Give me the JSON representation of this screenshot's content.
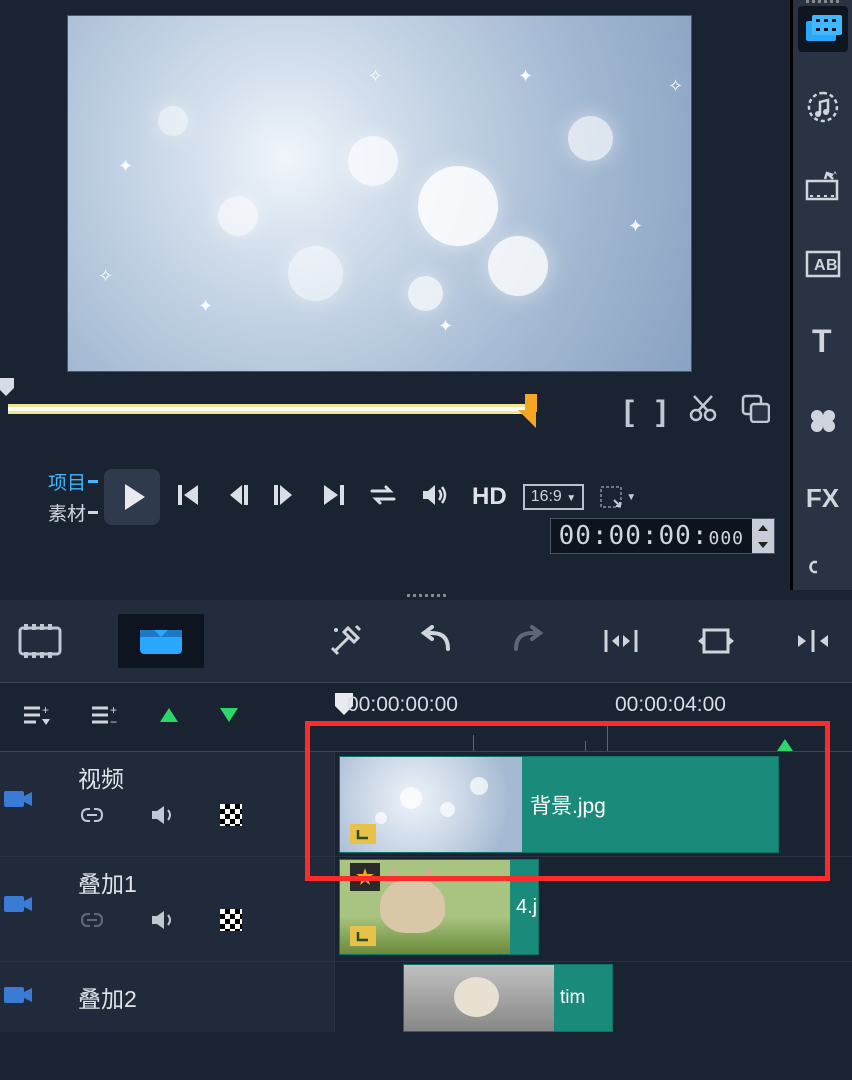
{
  "preview": {
    "mode_active": "项目",
    "mode_inactive": "素材",
    "hd_label": "HD",
    "ratio_label": "16:9",
    "timecode": "00:00:00:",
    "timecode_ms": "000",
    "tools": {
      "mark_in": "[",
      "mark_out": "]"
    }
  },
  "right_toolbar": {
    "items": [
      "media-library",
      "audio",
      "effects",
      "ab-compare",
      "title",
      "graphics",
      "fx",
      "link"
    ],
    "fx_label": "FX"
  },
  "timeline_ruler": {
    "t0": "00:00:00:00",
    "t1": "00:00:04:00"
  },
  "tracks": [
    {
      "name": "视频",
      "clip_label": "背景.jpg"
    },
    {
      "name": "叠加1",
      "clip_label": "4.j"
    },
    {
      "name": "叠加2",
      "clip_label": "tim"
    }
  ]
}
